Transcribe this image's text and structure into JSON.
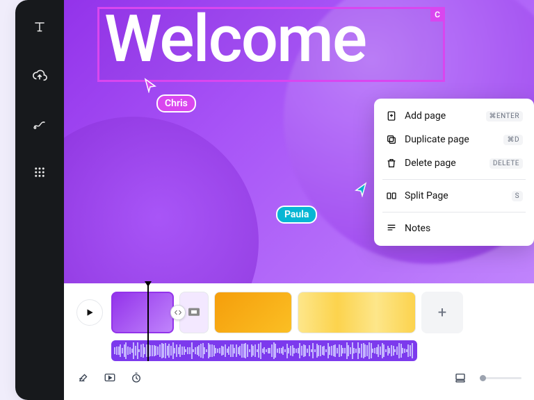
{
  "canvas": {
    "heading": "Welcome",
    "selection_corner_label": "C"
  },
  "collaborators": {
    "chris": {
      "name": "Chris",
      "color": "#d946ef"
    },
    "paula": {
      "name": "Paula",
      "color": "#06b6d4"
    }
  },
  "context_menu": {
    "add_page": {
      "label": "Add page",
      "shortcut": "⌘ENTER"
    },
    "duplicate_page": {
      "label": "Duplicate page",
      "shortcut": "⌘D"
    },
    "delete_page": {
      "label": "Delete page",
      "shortcut": "DELETE"
    },
    "split_page": {
      "label": "Split Page",
      "shortcut": "S"
    },
    "notes": {
      "label": "Notes"
    }
  },
  "timeline": {
    "add_clip_label": "+"
  },
  "sidebar": {
    "tools": [
      "text",
      "upload",
      "draw",
      "apps"
    ]
  }
}
